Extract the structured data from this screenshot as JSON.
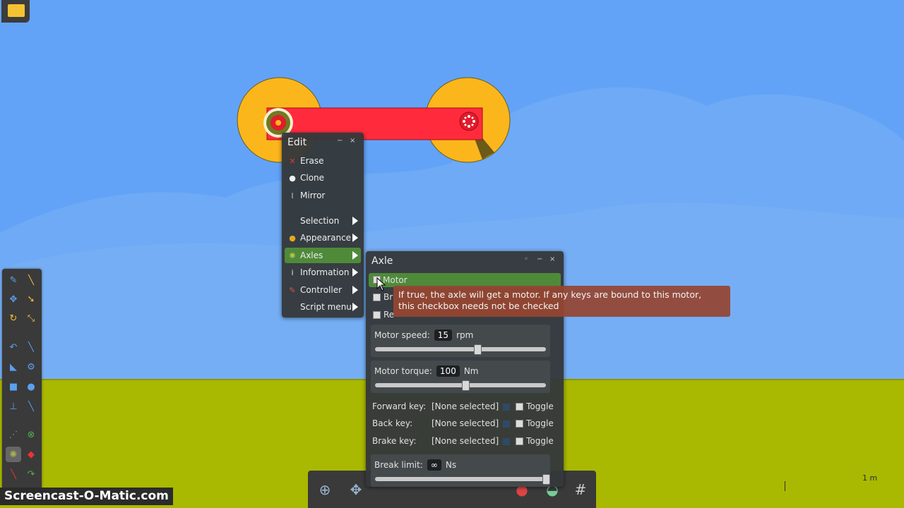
{
  "edit_menu": {
    "title": "Edit",
    "items": [
      {
        "label": "Erase",
        "icon": "x-icon"
      },
      {
        "label": "Clone",
        "icon": "clone-icon"
      },
      {
        "label": "Mirror",
        "icon": "mirror-icon"
      },
      {
        "label": "Selection",
        "icon": ""
      },
      {
        "label": "Appearance",
        "icon": "palette-icon"
      },
      {
        "label": "Axles",
        "icon": "axle-icon"
      },
      {
        "label": "Information",
        "icon": "info-icon"
      },
      {
        "label": "Controller",
        "icon": "controller-icon"
      },
      {
        "label": "Script menu",
        "icon": ""
      }
    ]
  },
  "axle_panel": {
    "title": "Axle",
    "checkbox_motor": "Motor",
    "checkbox_brake": "Br",
    "checkbox_reverse": "Re",
    "motor_speed_label": "Motor speed:",
    "motor_speed_value": "15",
    "motor_speed_unit": "rpm",
    "motor_speed_slider_fraction": 0.6,
    "motor_torque_label": "Motor torque:",
    "motor_torque_value": "100",
    "motor_torque_unit": "Nm",
    "motor_torque_slider_fraction": 0.53,
    "keys": [
      {
        "label": "Forward key:",
        "value": "[None selected]",
        "toggle": "Toggle"
      },
      {
        "label": "Back key:",
        "value": "[None selected]",
        "toggle": "Toggle"
      },
      {
        "label": "Brake key:",
        "value": "[None selected]",
        "toggle": "Toggle"
      }
    ],
    "break_limit_label": "Break limit:",
    "break_limit_value": "∞",
    "break_limit_unit": "Ns",
    "break_limit_slider_fraction": 1.0
  },
  "tooltip": {
    "line1": "If true, the axle will get a motor. If any keys are bound to this motor,",
    "line2": "this checkbox needs not be checked"
  },
  "scale_label": "1 m",
  "watermark": "Screencast-O-Matic.com",
  "colors": {
    "sky": "#5ea0f8",
    "ground": "#a9b800",
    "wheel": "#fbb61c",
    "bar": "#ff2b3d",
    "active_menu": "#4f8a3a",
    "tooltip": "#96462f"
  }
}
